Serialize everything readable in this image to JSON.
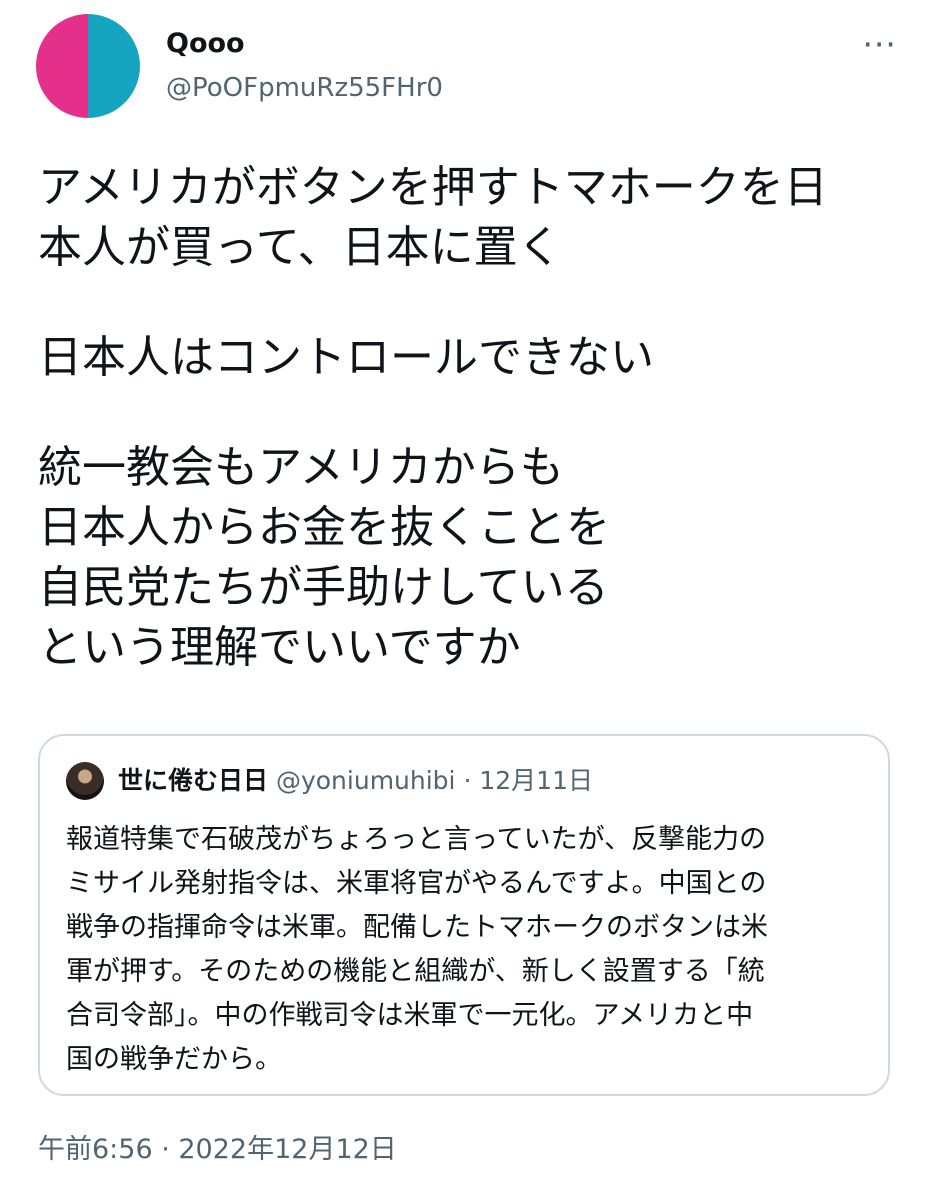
{
  "colors": {
    "avatar_left": "#e42f8b",
    "avatar_right": "#16a5c0",
    "secondary_text": "#536471",
    "border": "#cfd9de"
  },
  "author": {
    "display_name": "Qooo",
    "handle": "@PoOFpmuRz55FHr0",
    "avatar_icon": "split-color-avatar-icon"
  },
  "more_menu": {
    "label": "⋯",
    "icon": "more-horizontal-icon"
  },
  "tweet": {
    "lines": [
      "アメリカがボタンを押すトマホークを日",
      "本人が買って、日本に置く",
      "日本人はコントロールできない",
      "統一教会もアメリカからも",
      "日本人からお金を抜くことを",
      "自民党たちが手助けしている",
      "という理解でいいですか"
    ]
  },
  "quoted_tweet": {
    "author_name": "世に倦む日日",
    "handle": "@yoniumuhibi",
    "separator": "·",
    "date": "12月11日",
    "avatar_icon": "portrait-avatar-icon",
    "lines": [
      "報道特集で石破茂がちょろっと言っていたが、反撃能力の",
      "ミサイル発射指令は、米軍将官がやるんですよ。中国との",
      "戦争の指揮命令は米軍。配備したトマホークのボタンは米",
      "軍が押す。そのための機能と組織が、新しく設置する「統",
      "合司令部」。中の作戦司令は米軍で一元化。アメリカと中",
      "国の戦争だから。"
    ]
  },
  "timestamp": "午前6:56 · 2022年12月12日"
}
